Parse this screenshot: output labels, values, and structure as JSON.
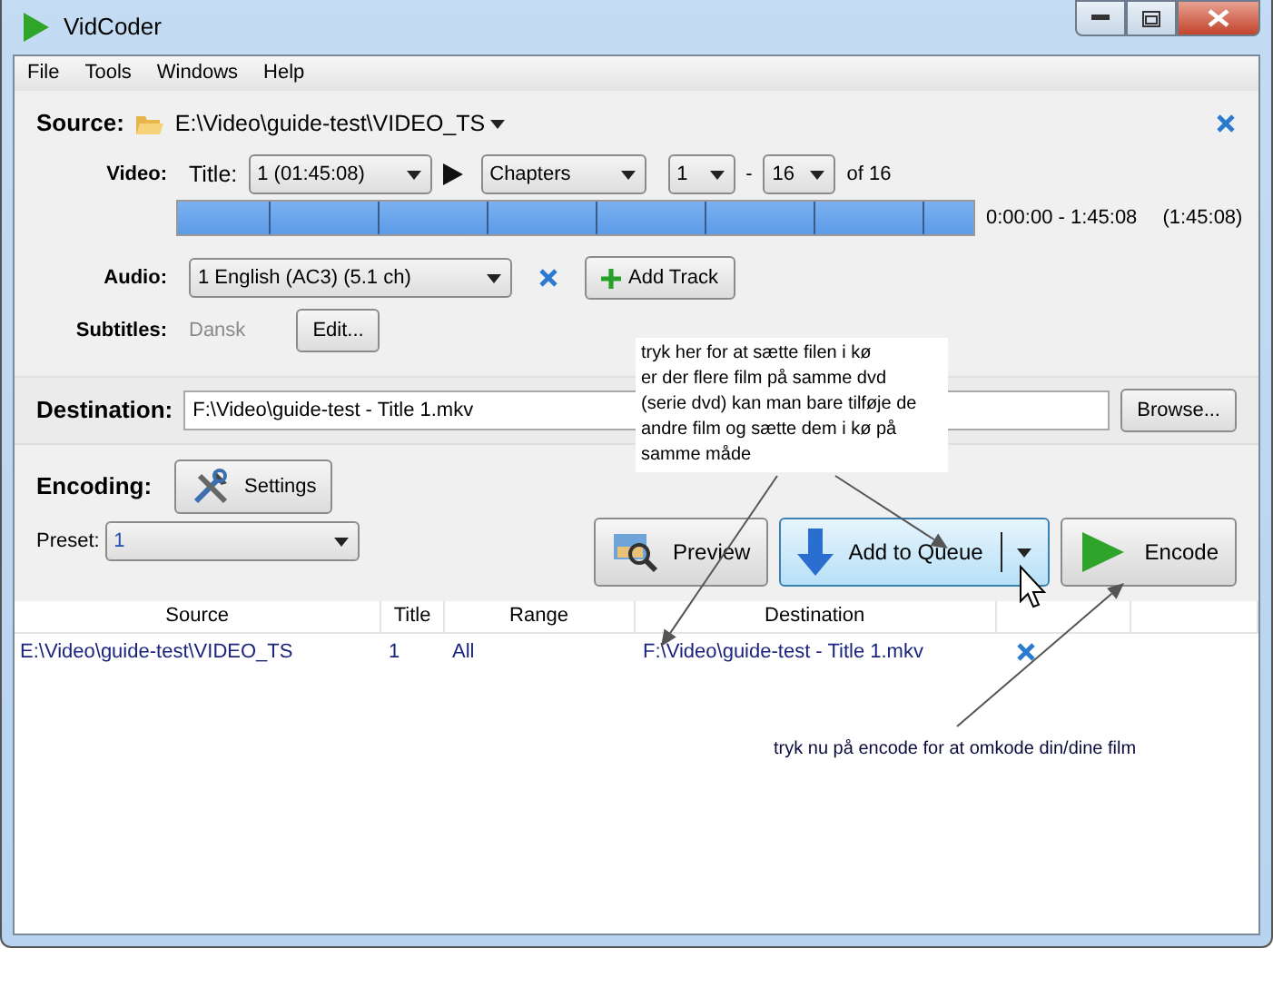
{
  "window": {
    "title": "VidCoder"
  },
  "menu": [
    "File",
    "Tools",
    "Windows",
    "Help"
  ],
  "source": {
    "label": "Source:",
    "path": "E:\\Video\\guide-test\\VIDEO_TS"
  },
  "video": {
    "label": "Video:",
    "title_label": "Title:",
    "title": "1 (01:45:08)",
    "range_type": "Chapters",
    "start": "1",
    "separator": "-",
    "end": "16",
    "of": "of 16",
    "level": 1,
    "time_range": "0:00:00 - 1:45:08",
    "duration": "(1:45:08)"
  },
  "audio": {
    "label": "Audio:",
    "track": "1 English (AC3) (5.1 ch)",
    "add_button": "Add Track"
  },
  "subtitles": {
    "label": "Subtitles:",
    "value": "Dansk",
    "edit_button": "Edit..."
  },
  "destination": {
    "label": "Destination:",
    "value": "F:\\Video\\guide-test - Title 1.mkv",
    "browse_button": "Browse..."
  },
  "encoding": {
    "label": "Encoding:",
    "settings_button": "Settings",
    "preset_label": "Preset:",
    "preset": "1"
  },
  "actions": [
    {
      "kind": "preview",
      "label": "Preview",
      "hovered": false
    },
    {
      "kind": "queue",
      "label": "Add to Queue",
      "hovered": true
    },
    {
      "kind": "encode",
      "label": "Encode",
      "hovered": false
    }
  ],
  "queue": {
    "columns": [
      "Source",
      "Title",
      "Range",
      "Destination"
    ],
    "rows": [
      {
        "source": "E:\\Video\\guide-test\\VIDEO_TS",
        "title": "1",
        "range": "All",
        "destination": "F:\\Video\\guide-test - Title 1.mkv"
      }
    ]
  },
  "annotations": [
    {
      "text": "tryk her for at sætte filen i kø\ner der flere film på samme dvd\n(serie dvd) kan man bare tilføje de\nandre film og sætte dem i kø på\nsamme måde"
    },
    {
      "text": "tryk nu på encode for at omkode din/dine film"
    }
  ]
}
